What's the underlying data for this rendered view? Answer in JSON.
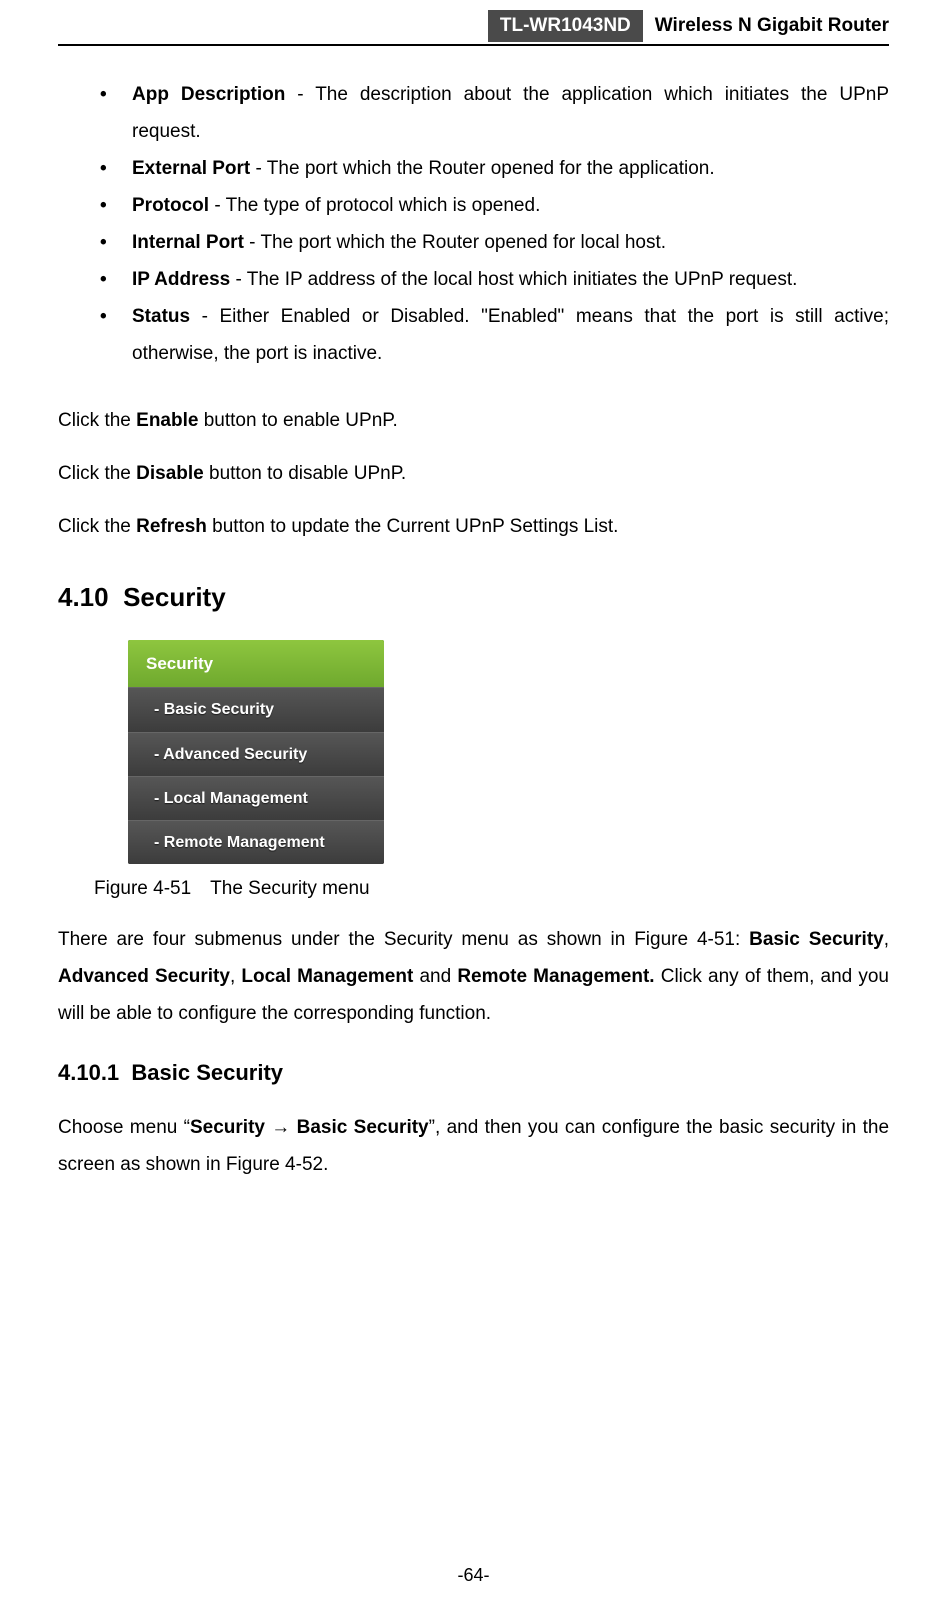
{
  "header": {
    "model": "TL-WR1043ND",
    "product": "Wireless N Gigabit Router"
  },
  "bullets": [
    {
      "term": "App Description",
      "desc": " - The description about the application which initiates the UPnP request."
    },
    {
      "term": "External Port",
      "desc": " - The port which the Router opened for the application."
    },
    {
      "term": "Protocol",
      "desc": " - The type of protocol which is opened."
    },
    {
      "term": "Internal Port",
      "desc": " - The port which the Router opened for local host."
    },
    {
      "term": "IP Address",
      "desc": " - The IP address of the local host which initiates the UPnP request."
    },
    {
      "term": "Status",
      "desc": " - Either Enabled or Disabled. \"Enabled\" means that the port is still active; otherwise, the port is inactive."
    }
  ],
  "actions": {
    "p1a": "Click the ",
    "p1b": "Enable",
    "p1c": " button to enable UPnP.",
    "p2a": "Click the ",
    "p2b": "Disable",
    "p2c": " button to disable UPnP.",
    "p3a": "Click the ",
    "p3b": "Refresh",
    "p3c": " button to update the Current UPnP Settings List."
  },
  "section": {
    "num": "4.10",
    "title": "Security"
  },
  "menu": {
    "header": "Security",
    "items": [
      "- Basic Security",
      "- Advanced Security",
      "- Local Management",
      "- Remote Management"
    ]
  },
  "figcaption": "Figure 4-51 The Security menu",
  "body1": {
    "a": "There are four submenus under the Security menu as shown in Figure 4-51: ",
    "b": "Basic Security",
    "c": ", ",
    "d": "Advanced Security",
    "e": ", ",
    "f": "Local Management",
    "g": " and ",
    "h": "Remote Management.",
    "i": " Click any of them, and you will be able to configure the corresponding function."
  },
  "subsection": {
    "num": "4.10.1",
    "title": "Basic Security"
  },
  "body2": {
    "a": "Choose menu “",
    "b": "Security → Basic Security",
    "c": "”, and then you can configure the basic security in the screen as shown in Figure 4-52."
  },
  "pagenum": "-64-"
}
